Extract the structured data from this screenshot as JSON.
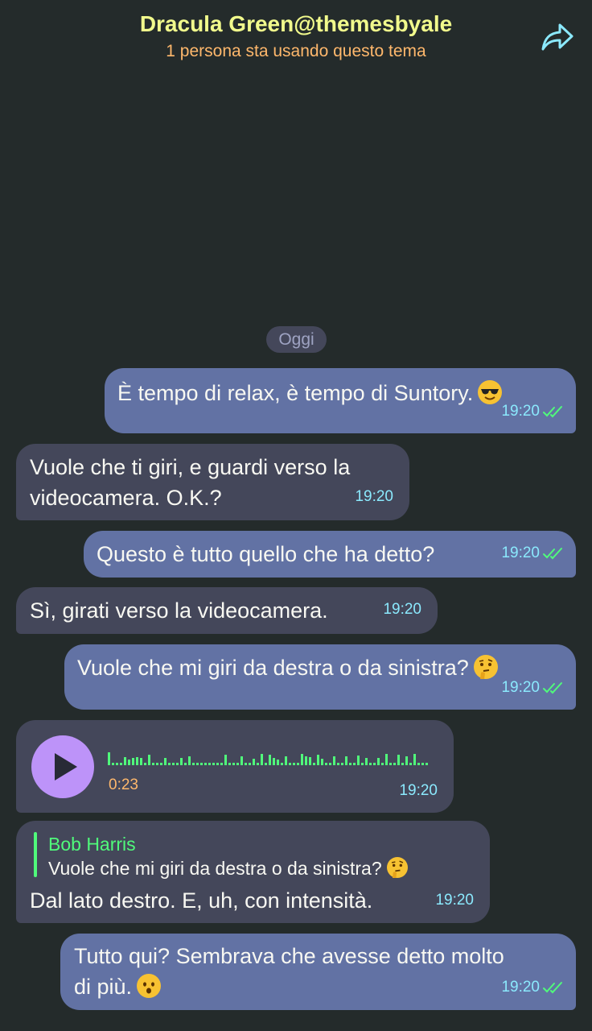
{
  "header": {
    "title": "Dracula Green@themesbyale",
    "subtitle": "1 persona sta usando questo tema",
    "share_icon": "share-forward-icon"
  },
  "date_separator": "Oggi",
  "colors": {
    "background": "#242b2b",
    "outgoing_bubble": "#6272a4",
    "incoming_bubble": "#44475a",
    "title": "#f1fa8c",
    "subtitle": "#ffb86c",
    "time": "#8be9fd",
    "read_ticks": "#50fa7b",
    "reply_name": "#50fa7b",
    "play_button": "#bd93f9"
  },
  "messages": [
    {
      "direction": "out",
      "text": "È tempo di relax, è tempo di Suntory.",
      "emoji": "smiling-face-with-sunglasses-emoji",
      "time": "19:20",
      "read": true
    },
    {
      "direction": "in",
      "lines": [
        "Vuole che ti giri, e guardi verso la",
        "videocamera. O.K.?"
      ],
      "time": "19:20"
    },
    {
      "direction": "out",
      "text": "Questo è tutto quello che ha detto?",
      "time": "19:20",
      "read": true
    },
    {
      "direction": "in",
      "text": "Sì, girati verso la videocamera.",
      "time": "19:20"
    },
    {
      "direction": "out",
      "text": "Vuole che mi giri da destra o da sinistra?",
      "emoji": "thinking-face-emoji",
      "time": "19:20",
      "read": true
    },
    {
      "direction": "in",
      "type": "voice",
      "duration": "0:23",
      "time": "19:20"
    },
    {
      "direction": "in",
      "reply_to": {
        "name": "Bob Harris",
        "text": "Vuole che mi giri da destra o da sinistra?",
        "emoji": "thinking-face-emoji"
      },
      "text": "Dal lato destro. E, uh, con intensità.",
      "time": "19:20"
    },
    {
      "direction": "out",
      "lines": [
        "Tutto qui? Sembrava che avesse detto molto",
        "di più."
      ],
      "emoji": "hushed-face-emoji",
      "time": "19:20",
      "read": true
    }
  ]
}
